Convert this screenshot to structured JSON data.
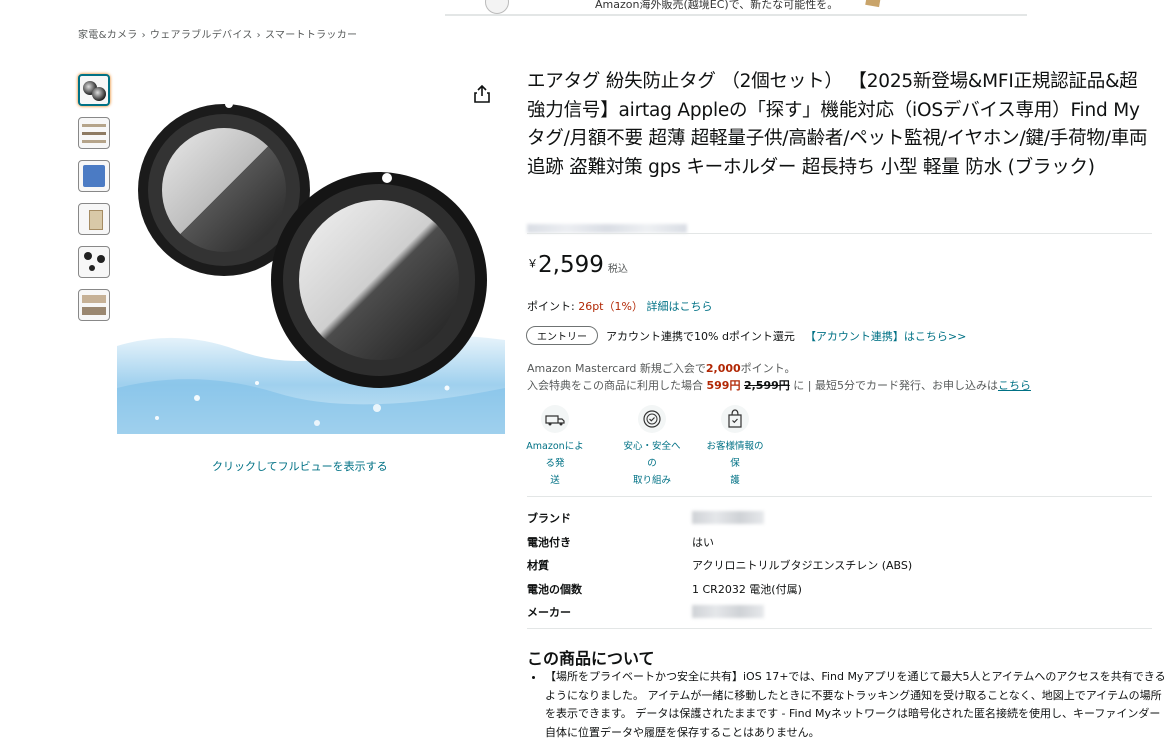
{
  "banner": {
    "text": "Amazon海外販売(越境EC)で、新たな可能性を。"
  },
  "breadcrumb": [
    "家電&カメラ",
    "ウェアラブルデバイス",
    "スマートトラッカー"
  ],
  "breadcrumb_sep": "›",
  "image": {
    "fullview_label": "クリックしてフルビューを表示する"
  },
  "product": {
    "title": "エアタグ 紛失防止タグ （2個セット） 【2025新登場&MFI正規認証品&超強力信号】airtag Appleの「探す」機能対応（iOSデバイス専用）Find Myタグ/月額不要 超薄 超軽量子供/高齢者/ペット監視/イヤホン/鍵/手荷物/車両追跡 盗難対策 gps キーホルダー 超長持ち 小型 軽量 防水 (ブラック)"
  },
  "price": {
    "currency": "￥",
    "amount": "2,599",
    "tax": "税込"
  },
  "points": {
    "label": "ポイント: ",
    "value": "26pt（1%）",
    "link": "詳細はこちら"
  },
  "entry": {
    "badge": "エントリー",
    "text": "アカウント連携で10% dポイント還元",
    "link": "【アカウント連携】はこちら>>"
  },
  "card_offer": {
    "line1_pre": "Amazon Mastercard 新規ご入会で",
    "line1_points": "2,000",
    "line1_post": "ポイント。",
    "line2_pre": "入会特典をこの商品に利用した場合 ",
    "line2_price": "599円",
    "line2_strike": "2,599円",
    "line2_mid": " に | 最短5分でカード発行、お申し込みは",
    "line2_link": "こちら"
  },
  "features": [
    {
      "icon": "delivery-truck-icon",
      "line1": "Amazonによる発",
      "line2": "送"
    },
    {
      "icon": "security-badge-icon",
      "line1": "安心・安全への",
      "line2": "取り組み"
    },
    {
      "icon": "protected-bag-icon",
      "line1": "お客様情報の保",
      "line2": "護"
    }
  ],
  "specs": [
    {
      "key": "ブランド",
      "value": "",
      "redacted": true
    },
    {
      "key": "電池付き",
      "value": "はい",
      "redacted": false
    },
    {
      "key": "材質",
      "value": "アクリロニトリルブタジエンスチレン (ABS)",
      "redacted": false
    },
    {
      "key": "電池の個数",
      "value": "1 CR2032 電池(付属)",
      "redacted": false
    },
    {
      "key": "メーカー",
      "value": "",
      "redacted": true
    }
  ],
  "about": {
    "title": "この商品について",
    "bullets": [
      "【場所をプライベートかつ安全に共有】iOS 17+では、Find Myアプリを通じて最大5人とアイテムへのアクセスを共有できるようになりました。 アイテムが一緒に移動したときに不要なトラッキング通知を受け取ることなく、地図上でアイテムの場所を表示できます。 データは保護されたままです - Find Myネットワークは暗号化された匿名接続を使用し、キーファインダー自体に位置データや履歴を保存することはありません。"
    ]
  },
  "colors": {
    "link": "#007185",
    "price_red": "#b12704",
    "text": "#0f1111",
    "muted": "#565959"
  }
}
